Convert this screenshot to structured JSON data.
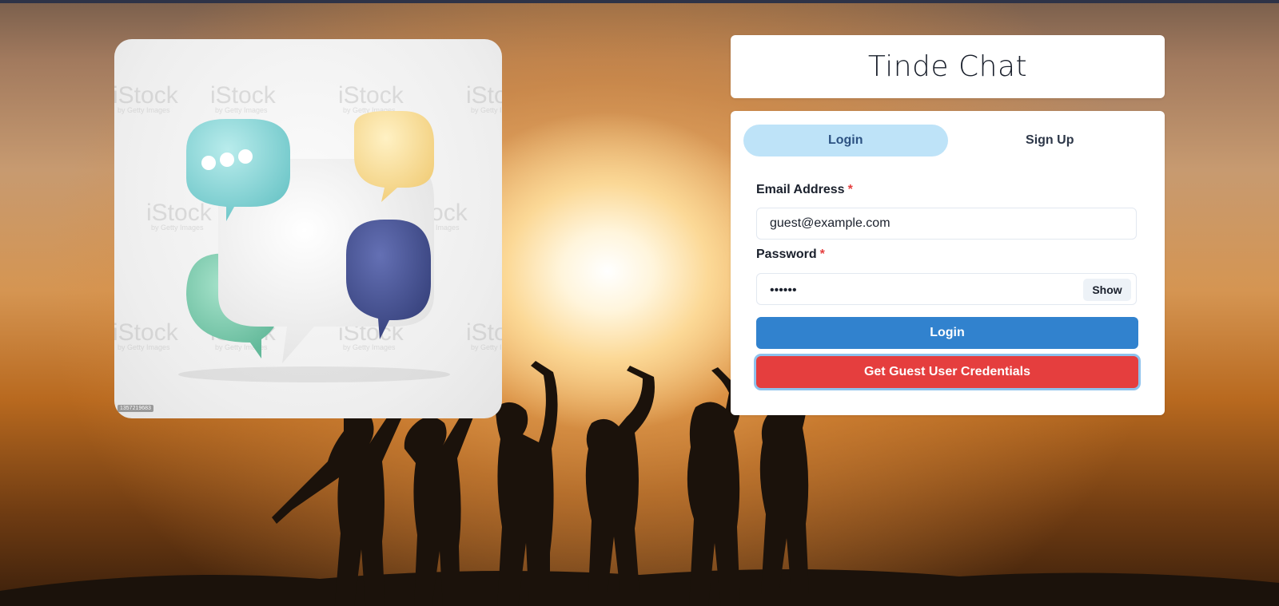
{
  "app": {
    "title": "Tinde Chat"
  },
  "hero": {
    "watermark": "iStock",
    "watermark_sub": "by Getty Images",
    "image_id": "1357219683"
  },
  "tabs": [
    {
      "label": "Login",
      "active": true
    },
    {
      "label": "Sign Up",
      "active": false
    }
  ],
  "form": {
    "email_label": "Email Address",
    "email_value": "guest@example.com",
    "password_label": "Password",
    "password_value": "••••••",
    "required_mark": "*",
    "show_label": "Show",
    "login_label": "Login",
    "guest_label": "Get Guest User Credentials"
  },
  "colors": {
    "primary": "#3182ce",
    "danger": "#e53e3e",
    "tab_active": "#bee3f8"
  }
}
